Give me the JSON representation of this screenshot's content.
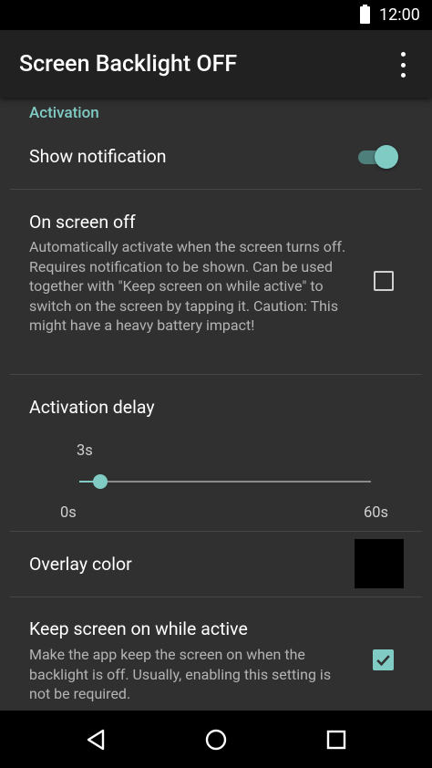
{
  "status_bar": {
    "time": "12:00",
    "battery_icon": "battery-full-icon"
  },
  "app_bar": {
    "title": "Screen Backlight OFF",
    "menu_icon": "more-vert-icon"
  },
  "accent_color": "#80cbc4",
  "section": {
    "header": "Activation"
  },
  "prefs": {
    "show_notification": {
      "title": "Show notification",
      "enabled": true
    },
    "on_screen_off": {
      "title": "On screen off",
      "summary": "Automatically activate when the screen turns off. Requires notification to be shown. Can be used together with \"Keep screen on while active\" to switch on the screen by tapping it. Caution: This might have a heavy battery impact!",
      "checked": false
    },
    "activation_delay": {
      "title": "Activation delay",
      "value_label": "3s",
      "min_label": "0s",
      "max_label": "60s",
      "value": 3,
      "min": 0,
      "max": 60
    },
    "overlay_color": {
      "title": "Overlay color",
      "color": "#000000"
    },
    "keep_screen_on": {
      "title": "Keep screen on while active",
      "summary": "Make the app keep the screen on when the backlight is off. Usually, enabling this setting is not be required.",
      "checked": true
    }
  },
  "nav_bar": {
    "back_icon": "back-icon",
    "home_icon": "home-icon",
    "recents_icon": "recents-icon"
  }
}
